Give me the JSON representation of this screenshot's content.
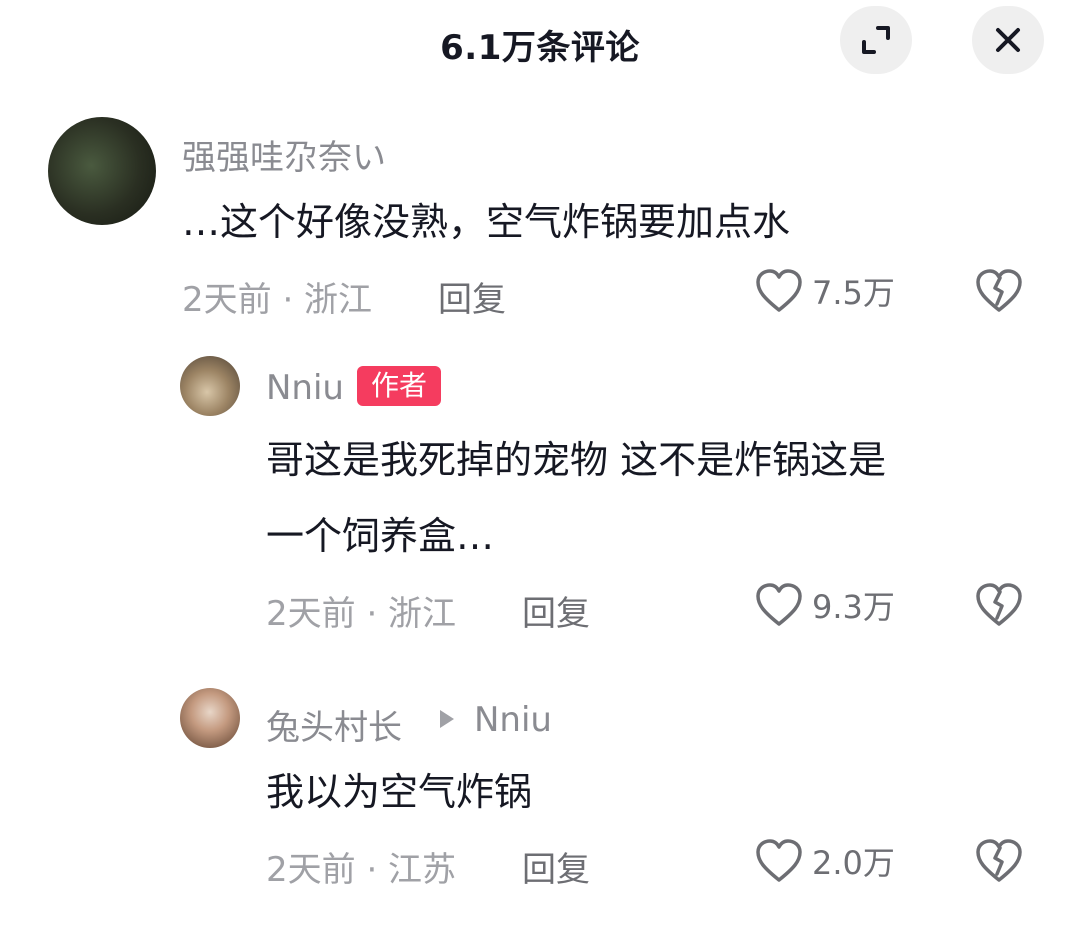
{
  "header": {
    "title": "6.1万条评论",
    "expand_icon": "expand-icon",
    "close_icon": "close-icon"
  },
  "comments": [
    {
      "username": "强强哇尕奈い",
      "text": "…这个好像没熟，空气炸锅要加点水",
      "meta": "2天前 · 浙江",
      "reply_label": "回复",
      "likes": "7.5万"
    }
  ],
  "replies": [
    {
      "username": "Nniu",
      "badge": "作者",
      "text_line1": "哥这是我死掉的宠物 这不是炸锅这是",
      "text_line2": "一个饲养盒…",
      "meta": "2天前 · 浙江",
      "reply_label": "回复",
      "likes": "9.3万"
    },
    {
      "username": "兔头村长",
      "reply_to": "Nniu",
      "text": "我以为空气炸锅",
      "meta": "2天前 · 江苏",
      "reply_label": "回复",
      "likes": "2.0万"
    }
  ],
  "icons": {
    "like": "heart-outline-icon",
    "dislike": "broken-heart-icon"
  }
}
